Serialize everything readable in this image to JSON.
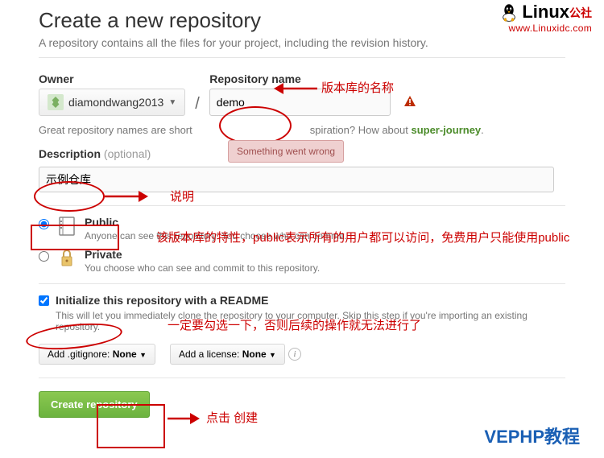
{
  "page": {
    "title": "Create a new repository",
    "subtitle": "A repository contains all the files for your project, including the revision history."
  },
  "owner": {
    "label": "Owner",
    "username": "diamondwang2013"
  },
  "repo": {
    "label": "Repository name",
    "value": "demo",
    "error": "Something went wrong"
  },
  "hint": {
    "prefix": "Great repository names are short ",
    "mid": "spiration? How about ",
    "suggestion": "super-journey",
    "suffix": "."
  },
  "description": {
    "label": "Description",
    "optional": "(optional)",
    "value": "示例仓库"
  },
  "visibility": {
    "public": {
      "label": "Public",
      "desc": "Anyone can see this repository. You choose who can commit."
    },
    "private": {
      "label": "Private",
      "desc": "You choose who can see and commit to this repository."
    }
  },
  "readme": {
    "label": "Initialize this repository with a README",
    "desc": "This will let you immediately clone the repository to your computer. Skip this step if you're importing an existing repository."
  },
  "dropdowns": {
    "gitignore_prefix": "Add .gitignore: ",
    "gitignore_value": "None",
    "license_prefix": "Add a license: ",
    "license_value": "None"
  },
  "submit": {
    "label": "Create repository"
  },
  "annotations": {
    "a1": "版本库的名称",
    "a2": "说明",
    "a3": "该版本库的特性，public表示所有的用户都可以访问，免费用户只能使用public",
    "a4": "一定要勾选一下，否则后续的操作就无法进行了",
    "a5": "点击  创建"
  },
  "watermarks": {
    "linux_brand": "Linux",
    "linux_suffix": "公社",
    "linux_url": "www.Linuxidc.com",
    "vephp": "VEPHP教程"
  }
}
